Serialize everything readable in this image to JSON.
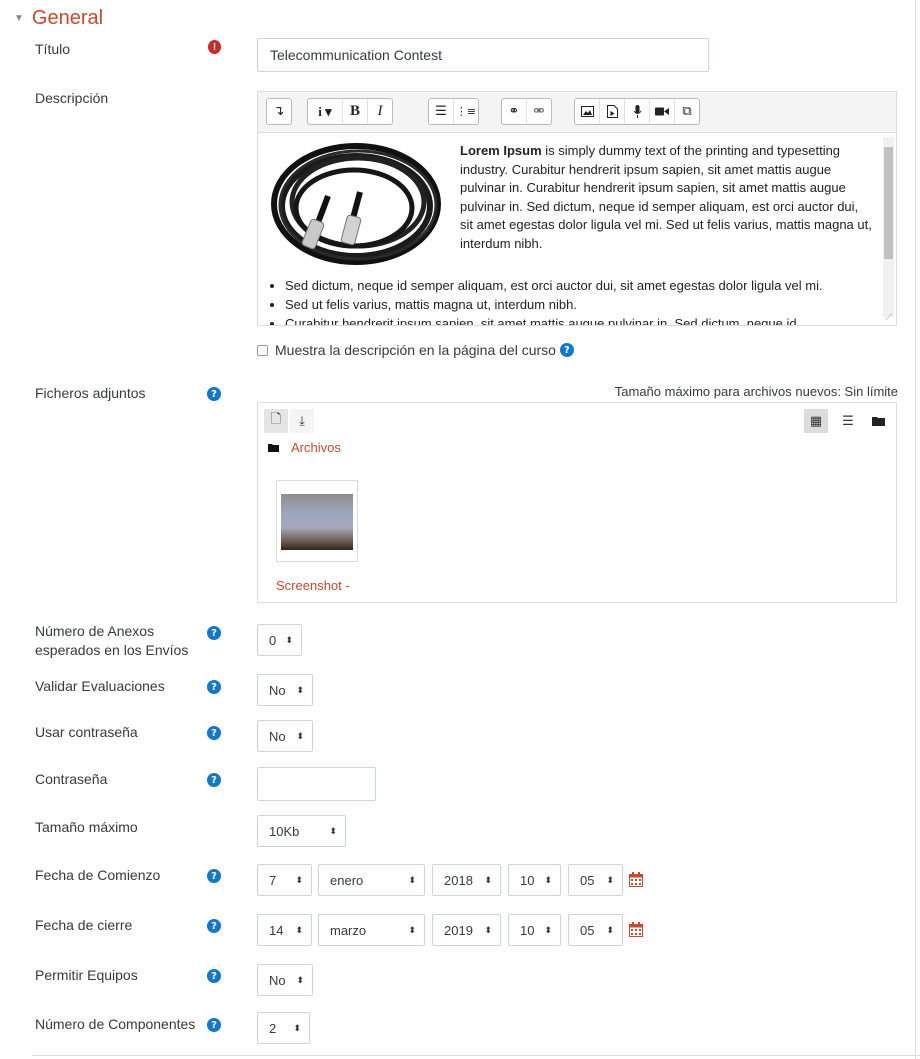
{
  "section": {
    "title": "General"
  },
  "fields": {
    "titulo": {
      "label": "Título",
      "value": "Telecommunication Contest"
    },
    "descripcion": {
      "label": "Descripción"
    },
    "show_description": {
      "label": "Muestra la descripción en la página del curso",
      "checked": false
    },
    "ficheros": {
      "label": "Ficheros adjuntos",
      "max_size_text": "Tamaño máximo para archivos nuevos: Sin límite"
    },
    "num_anexos": {
      "label_line1": "Número de Anexos",
      "label_line2": "esperados en los Envíos",
      "value": "0"
    },
    "validar": {
      "label": "Validar Evaluaciones",
      "value": "No"
    },
    "usar_pass": {
      "label": "Usar contraseña",
      "value": "No"
    },
    "contrasena": {
      "label": "Contraseña",
      "value": ""
    },
    "tamano_max": {
      "label": "Tamaño máximo",
      "value": "10Kb"
    },
    "fecha_comienzo": {
      "label": "Fecha de Comienzo",
      "day": "7",
      "month": "enero",
      "year": "2018",
      "hour": "10",
      "minute": "05"
    },
    "fecha_cierre": {
      "label": "Fecha de cierre",
      "day": "14",
      "month": "marzo",
      "year": "2019",
      "hour": "10",
      "minute": "05"
    },
    "permitir_equipos": {
      "label": "Permitir Equipos",
      "value": "No"
    },
    "num_componentes": {
      "label": "Número de Componentes",
      "value": "2"
    }
  },
  "editor": {
    "bold_lead": "Lorem Ipsum",
    "paragraph": " is simply dummy text of the printing and typesetting industry. Curabitur hendrerit ipsum sapien, sit amet mattis augue pulvinar in. Curabitur hendrerit ipsum sapien, sit amet mattis augue pulvinar in. Sed dictum, neque id semper aliquam, est orci auctor dui, sit amet egestas dolor ligula vel mi. Sed ut felis varius, mattis magna ut, interdum nibh.",
    "bullets": [
      "Sed dictum, neque id semper aliquam, est orci auctor dui, sit amet egestas dolor ligula vel mi.",
      "Sed ut felis varius, mattis magna ut, interdum nibh.",
      "Curabitur hendrerit ipsum sapien, sit amet mattis augue pulvinar in. Sed dictum, neque id"
    ],
    "toolbar_icons": [
      "collapse-icon",
      "paragraph-style-icon",
      "bold-icon",
      "italic-icon",
      "unordered-list-icon",
      "ordered-list-icon",
      "link-icon",
      "unlink-icon",
      "image-icon",
      "media-icon",
      "record-audio-icon",
      "record-video-icon",
      "manage-files-icon"
    ]
  },
  "filemanager": {
    "path_label": "Archivos",
    "files": [
      {
        "name": "Screenshot -"
      }
    ]
  },
  "colors": {
    "accent": "#c84a2b",
    "help": "#1177d1",
    "required": "#c92a2a",
    "calendar": "#c84a2b"
  }
}
